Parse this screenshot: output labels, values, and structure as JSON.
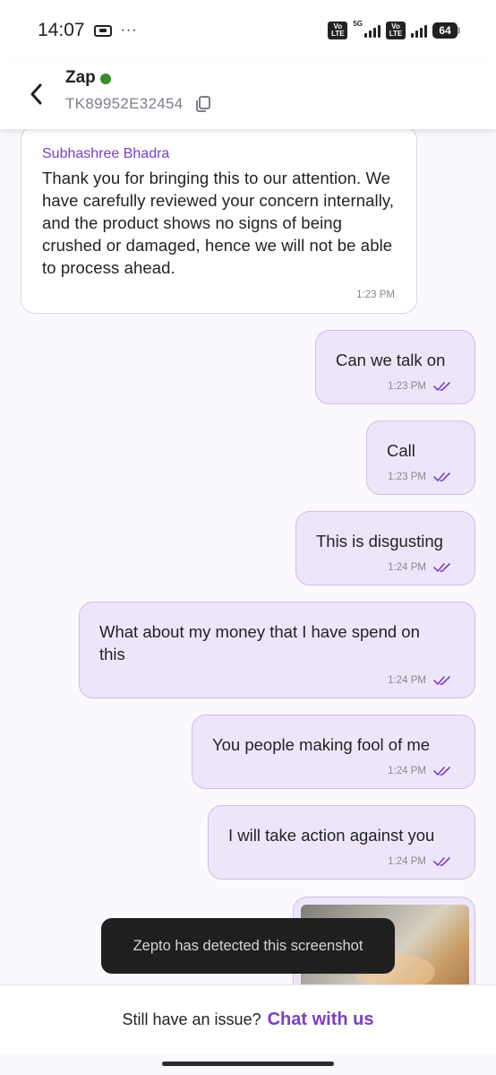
{
  "status_bar": {
    "time": "14:07",
    "dots": "···",
    "volte1": "Vo LTE",
    "network_type": "5G",
    "volte2": "Vo LTE",
    "battery": "64"
  },
  "header": {
    "title": "Zap",
    "ticket_id": "TK89952E32454",
    "online_color": "#3a8a2e"
  },
  "messages": [
    {
      "sender": "Subhashree Bhadra",
      "text": "Thank you for bringing this to our attention. We have carefully reviewed your concern internally, and the product shows no signs of being crushed or damaged, hence we will not be able to process ahead.",
      "time": "1:23 PM"
    },
    {
      "text": "Can we talk on",
      "time": "1:23 PM"
    },
    {
      "text": "Call",
      "time": "1:23 PM"
    },
    {
      "text": "This is disgusting",
      "time": "1:24 PM"
    },
    {
      "text": "What about my money that I have spend on\nthis",
      "time": "1:24 PM"
    },
    {
      "text": "You people making fool of me",
      "time": "1:24 PM"
    },
    {
      "text": "I will take action against you",
      "time": "1:24 PM"
    }
  ],
  "toast": "Zepto has detected this screenshot",
  "footer": {
    "question": "Still have an issue?",
    "link": "Chat with us"
  },
  "colors": {
    "accent": "#7b3fc4",
    "user_bubble": "#ede6fb"
  }
}
